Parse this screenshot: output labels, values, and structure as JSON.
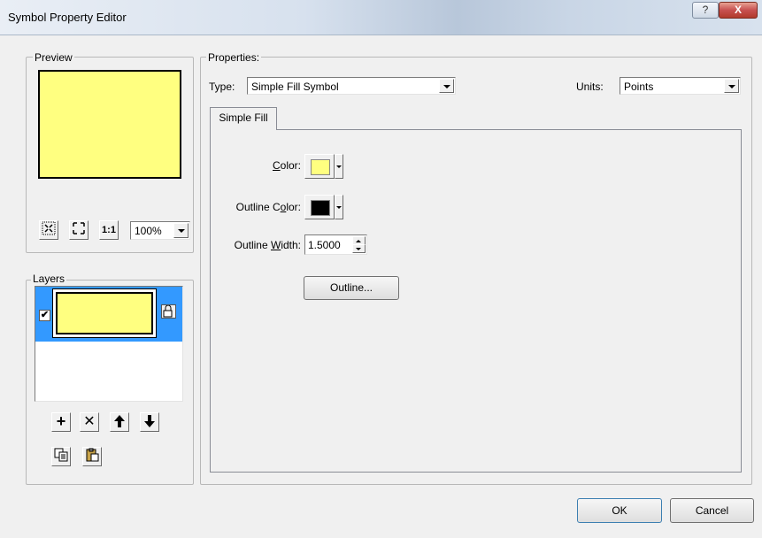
{
  "window": {
    "title": "Symbol Property Editor",
    "help_glyph": "?",
    "close_glyph": "X"
  },
  "preview": {
    "label": "Preview",
    "fill_color": "#ffff80",
    "outline_color": "#000000",
    "zoom_value": "100%",
    "actual_size_glyph": "1:1"
  },
  "layers": {
    "label": "Layers",
    "items": [
      {
        "checked": true,
        "fill_color": "#ffff80",
        "selected": true
      }
    ],
    "add_glyph": "+",
    "remove_glyph": "✕",
    "up_glyph": "🡅",
    "down_glyph": "🡇"
  },
  "properties": {
    "label": "Properties:",
    "type_label": "Type:",
    "type_value": "Simple Fill Symbol",
    "units_label": "Units:",
    "units_value": "Points",
    "tab_label": "Simple Fill",
    "color_label_pre": "",
    "color_label_u": "C",
    "color_label_post": "olor:",
    "color_value": "#ffff80",
    "outline_color_label_pre": "Outline C",
    "outline_color_label_u": "o",
    "outline_color_label_post": "lor:",
    "outline_color_value": "#000000",
    "outline_width_label_pre": "Outline ",
    "outline_width_label_u": "W",
    "outline_width_label_post": "idth:",
    "outline_width_value": "1.5000",
    "outline_button": "Outline..."
  },
  "footer": {
    "ok": "OK",
    "cancel": "Cancel"
  },
  "colors": {
    "accent_selection": "#3399ff",
    "swatch_yellow": "#ffff80"
  }
}
